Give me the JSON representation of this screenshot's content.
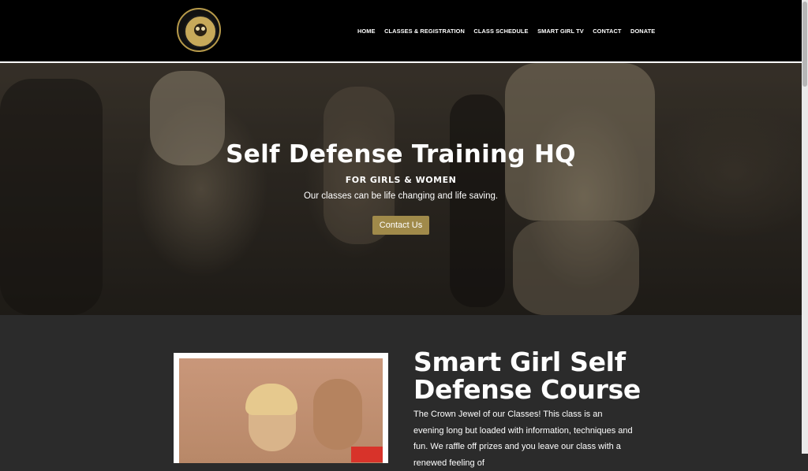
{
  "header": {
    "logo_icon": "owl-crest-logo",
    "nav": [
      {
        "label": "HOME"
      },
      {
        "label": "CLASSES & REGISTRATION"
      },
      {
        "label": "CLASS SCHEDULE"
      },
      {
        "label": "SMART GIRL TV"
      },
      {
        "label": "CONTACT"
      },
      {
        "label": "DONATE"
      }
    ]
  },
  "hero": {
    "title": "Self Defense Training HQ",
    "subtitle": "FOR GIRLS & WOMEN",
    "text": "Our classes can be life changing and life saving.",
    "button_label": "Contact Us",
    "accent": "#a08a4a"
  },
  "course": {
    "title": "Smart Girl Self Defense Course",
    "text": "The Crown Jewel of our Classes! This class is an evening long but loaded with information, techniques and fun. We raffle off prizes and you leave our class with a renewed feeling of"
  }
}
